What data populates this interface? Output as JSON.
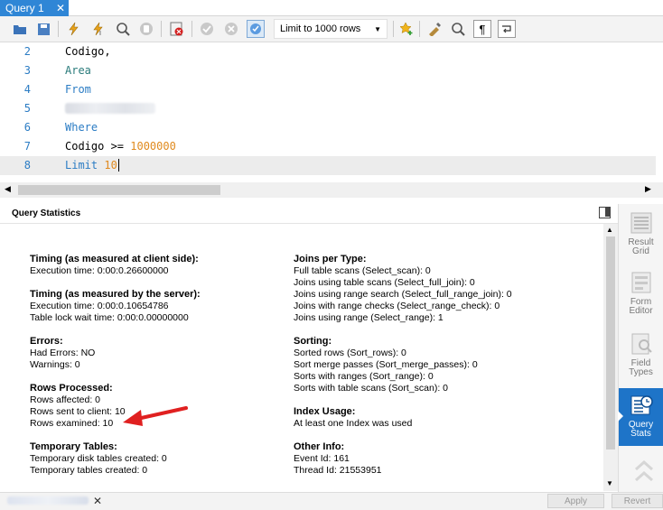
{
  "tabs": [
    {
      "label": "Query 1",
      "close": "✕"
    }
  ],
  "toolbar": {
    "limit_select": "Limit to 1000 rows",
    "icons": [
      "open-folder-icon",
      "save-icon",
      "execute-icon",
      "execute-current-icon",
      "explain-icon",
      "stop-icon",
      "toggle-error-icon",
      "commit-icon",
      "rollback-icon",
      "autocommit-icon",
      "bookmark-add-icon",
      "beautify-icon",
      "find-icon",
      "invisible-chars-icon",
      "wrap-icon"
    ]
  },
  "editor": {
    "lines": [
      {
        "num": "2",
        "text": "Codigo,",
        "style": "plain"
      },
      {
        "num": "3",
        "text": "Area",
        "style": "ident"
      },
      {
        "num": "4",
        "text": "From",
        "style": "kw"
      },
      {
        "num": "5",
        "text": "",
        "style": "blurred"
      },
      {
        "num": "6",
        "text": "Where",
        "style": "kw"
      },
      {
        "num": "7a",
        "text": "Codigo >= ",
        "style": "plain"
      },
      {
        "num": "7",
        "text": "1000000",
        "style": "num"
      },
      {
        "num": "8",
        "text": "Limit ",
        "style": "kw"
      },
      {
        "num": "8b",
        "text": "10",
        "style": "num"
      }
    ]
  },
  "stats": {
    "header": "Query Statistics",
    "left": [
      {
        "bold": "Timing (as measured at client side):"
      },
      {
        "text": "Execution time: 0:00:0.26600000"
      },
      {
        "bold": "Timing (as measured by the server):"
      },
      {
        "text": "Execution time: 0:00:0.10654786"
      },
      {
        "text": "Table lock wait time: 0:00:0.00000000"
      },
      {
        "bold": "Errors:"
      },
      {
        "text": "Had Errors: NO"
      },
      {
        "text": "Warnings: 0"
      },
      {
        "bold": "Rows Processed:"
      },
      {
        "text": "Rows affected: 0"
      },
      {
        "text": "Rows sent to client: 10"
      },
      {
        "text": "Rows examined: 10"
      },
      {
        "bold": "Temporary Tables:"
      },
      {
        "text": "Temporary disk tables created: 0"
      },
      {
        "text": "Temporary tables created: 0"
      }
    ],
    "right": [
      {
        "bold": "Joins per Type:"
      },
      {
        "text": "Full table scans (Select_scan): 0"
      },
      {
        "text": "Joins using table scans (Select_full_join): 0"
      },
      {
        "text": "Joins using range search (Select_full_range_join): 0"
      },
      {
        "text": "Joins with range checks (Select_range_check): 0"
      },
      {
        "text": "Joins using range (Select_range): 1"
      },
      {
        "bold": "Sorting:"
      },
      {
        "text": "Sorted rows (Sort_rows): 0"
      },
      {
        "text": "Sort merge passes (Sort_merge_passes): 0"
      },
      {
        "text": "Sorts with ranges (Sort_range): 0"
      },
      {
        "text": "Sorts with table scans (Sort_scan): 0"
      },
      {
        "bold": "Index Usage:"
      },
      {
        "text": "At least one Index was used"
      },
      {
        "bold": "Other Info:"
      },
      {
        "text": "Event Id: 161"
      },
      {
        "text": "Thread Id: 21553951"
      }
    ]
  },
  "sidebar": {
    "items": [
      {
        "label1": "Result",
        "label2": "Grid"
      },
      {
        "label1": "Form",
        "label2": "Editor"
      },
      {
        "label1": "Field",
        "label2": "Types"
      },
      {
        "label1": "Query",
        "label2": "Stats"
      }
    ]
  },
  "bottom": {
    "close": "✕",
    "apply": "Apply",
    "revert": "Revert"
  },
  "colors": {
    "accent": "#1e74c8",
    "tab": "#2f86d6",
    "arrow": "#e02020"
  }
}
